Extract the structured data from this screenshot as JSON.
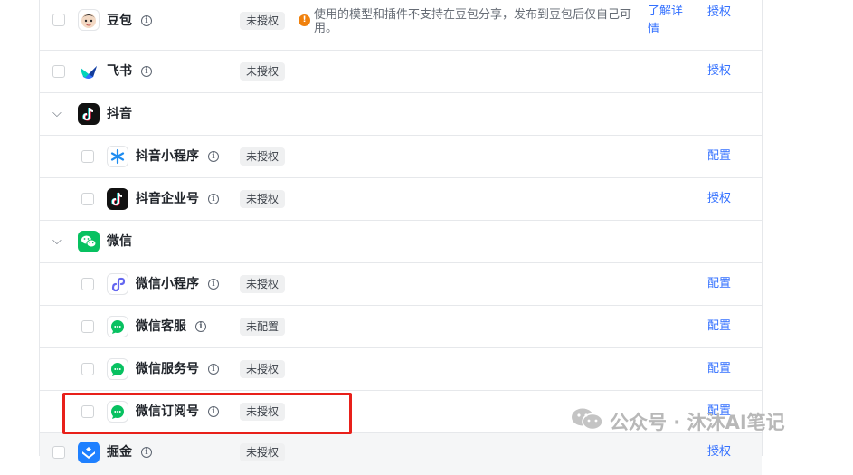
{
  "rows": {
    "doubao": {
      "name": "豆包",
      "status": "未授权",
      "warning": "使用的模型和插件不支持在豆包分享，发布到豆包后仅自己可用。",
      "detail_link": "了解详情",
      "action": "授权"
    },
    "feishu": {
      "name": "飞书",
      "status": "未授权",
      "action": "授权"
    },
    "douyin_group": {
      "name": "抖音"
    },
    "douyin_mini": {
      "name": "抖音小程序",
      "status": "未授权",
      "action": "配置"
    },
    "douyin_biz": {
      "name": "抖音企业号",
      "status": "未授权",
      "action": "授权"
    },
    "wechat_group": {
      "name": "微信"
    },
    "wechat_mini": {
      "name": "微信小程序",
      "status": "未授权",
      "action": "配置"
    },
    "wechat_cs": {
      "name": "微信客服",
      "status": "未配置",
      "action": "配置"
    },
    "wechat_service": {
      "name": "微信服务号",
      "status": "未授权",
      "action": "配置"
    },
    "wechat_sub": {
      "name": "微信订阅号",
      "status": "未授权",
      "action": "配置"
    },
    "juejin": {
      "name": "掘金",
      "status": "未授权",
      "action": "授权"
    }
  },
  "watermark": {
    "text": "公众号 · 沐沐AI笔记"
  },
  "colors": {
    "link": "#3370ff",
    "highlight": "#e8201a",
    "warning": "#f0810d",
    "wechat_green": "#07c160"
  }
}
